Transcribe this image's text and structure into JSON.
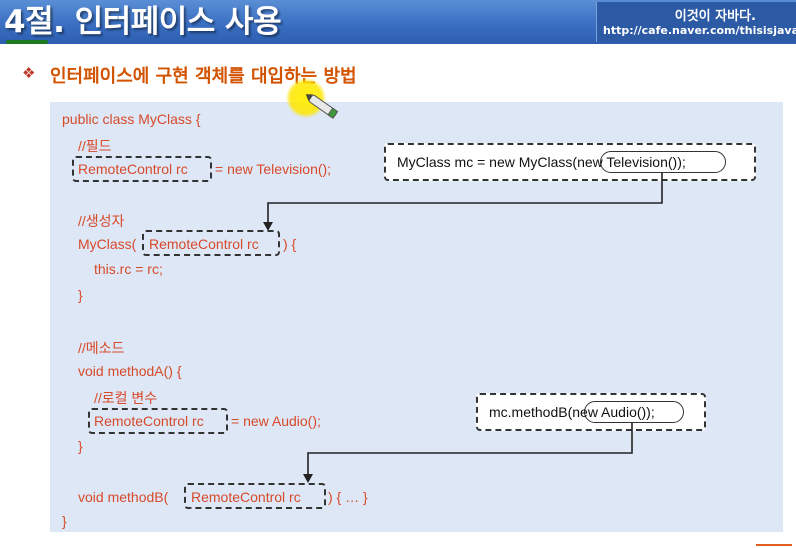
{
  "header": {
    "title": "4절. 인터페이스 사용",
    "brand_title": "이것이 자바다.",
    "brand_url": "http://cafe.naver.com/thisisjava"
  },
  "section": {
    "bullet": "❖",
    "title": "인터페이스에 구현 객체를 대입하는 방법"
  },
  "code": {
    "line1": "public class MyClass {",
    "comment_field": "//필드",
    "field_type": "RemoteControl rc",
    "field_rest": "= new Television();",
    "comment_ctor": "//생성자",
    "ctor_start": "MyClass(",
    "ctor_param": "RemoteControl rc",
    "ctor_end": ") {",
    "ctor_body": "this.rc = rc;",
    "ctor_close": "}",
    "comment_method": "//메소드",
    "methodA_sig": "void methodA() {",
    "comment_local": "//로컬 변수",
    "local_type": "RemoteControl rc",
    "local_rest": "= new Audio();",
    "methodA_close": "}",
    "methodB_start": "void methodB(",
    "methodB_param": "RemoteControl rc",
    "methodB_end": ") { … }",
    "class_close": "}"
  },
  "calls": {
    "call1": "MyClass mc = new MyClass(new Television());",
    "call2": "mc.methodB(new Audio());"
  },
  "colors": {
    "header_bg": "#3a6fc2",
    "code_text": "#d84a2a",
    "panel_bg": "#dde7f6",
    "section_title": "#d35400"
  }
}
